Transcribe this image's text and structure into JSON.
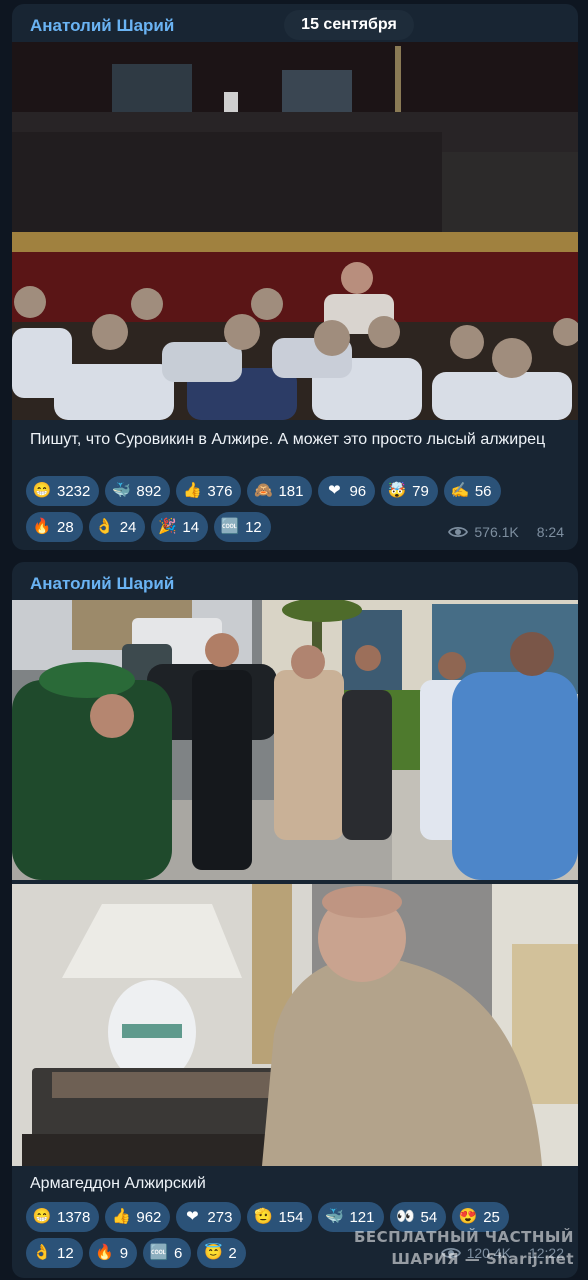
{
  "date_pill": "15 сентября",
  "post1": {
    "sender": "Анатолий Шарий",
    "caption": "Пишут, что Суровикин в Алжире. А может это просто лысый алжирец",
    "reactions_row1": [
      {
        "emoji": "😁",
        "icon": "grin-icon",
        "count": "3232"
      },
      {
        "emoji": "🐳",
        "icon": "whale-icon",
        "count": "892"
      },
      {
        "emoji": "👍",
        "icon": "thumbs-up-icon",
        "count": "376"
      },
      {
        "emoji": "🙈",
        "icon": "see-no-evil-monkey-icon",
        "count": "181"
      },
      {
        "emoji": "❤",
        "icon": "heart-icon",
        "count": "96"
      },
      {
        "emoji": "🤯",
        "icon": "exploding-head-icon",
        "count": "79"
      },
      {
        "emoji": "✍",
        "icon": "writing-hand-icon",
        "count": "56"
      }
    ],
    "reactions_row2": [
      {
        "emoji": "🔥",
        "icon": "fire-icon",
        "count": "28"
      },
      {
        "emoji": "👌",
        "icon": "ok-hand-icon",
        "count": "24"
      },
      {
        "emoji": "🎉",
        "icon": "party-popper-icon",
        "count": "14"
      },
      {
        "emoji": "🆒",
        "icon": "cool-icon",
        "count": "12"
      }
    ],
    "views": "576.1K",
    "time": "8:24"
  },
  "post2": {
    "sender": "Анатолий Шарий",
    "caption": "Армагеддон Алжирский",
    "reactions_row1": [
      {
        "emoji": "😁",
        "icon": "grin-icon",
        "count": "1378"
      },
      {
        "emoji": "👍",
        "icon": "thumbs-up-icon",
        "count": "962"
      },
      {
        "emoji": "❤",
        "icon": "heart-icon",
        "count": "273"
      },
      {
        "emoji": "🫡",
        "icon": "pointing-hand-icon",
        "count": "154"
      },
      {
        "emoji": "🐳",
        "icon": "whale-icon",
        "count": "121"
      },
      {
        "emoji": "👀",
        "icon": "eyes-icon",
        "count": "54"
      },
      {
        "emoji": "😍",
        "icon": "heart-eyes-icon",
        "count": "25"
      }
    ],
    "reactions_row2": [
      {
        "emoji": "👌",
        "icon": "ok-hand-icon",
        "count": "12"
      },
      {
        "emoji": "🔥",
        "icon": "fire-icon",
        "count": "9"
      },
      {
        "emoji": "🆒",
        "icon": "cool-icon",
        "count": "6"
      },
      {
        "emoji": "😇",
        "icon": "angel-face-icon",
        "count": "2"
      }
    ],
    "views": "120.4K",
    "time": "12:22"
  },
  "watermark": {
    "line1": "БЕСПЛАТНЫЙ ЧАСТНЫЙ",
    "line2": "ШАРИЯ — Sharij.net"
  },
  "colors": {
    "background": "#0e1621",
    "bubble": "#182533",
    "sender": "#6ab3f3",
    "reaction_pill": "#2b5278",
    "meta": "#7d8e9f"
  }
}
